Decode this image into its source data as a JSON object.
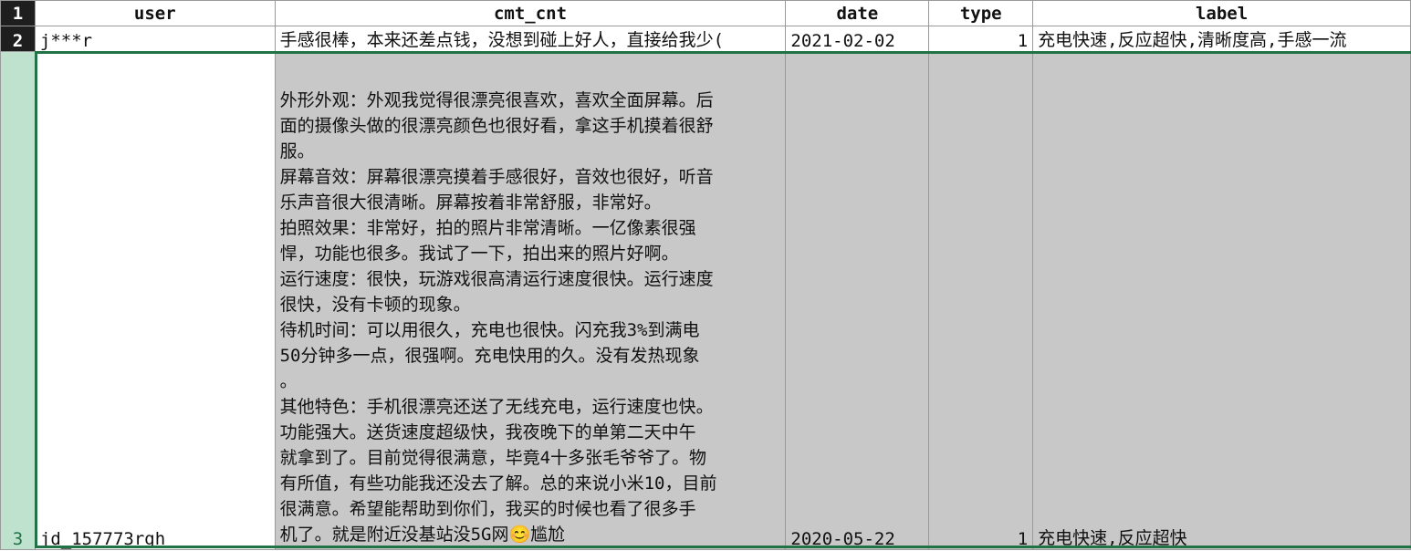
{
  "columns": [
    "user",
    "cmt_cnt",
    "date",
    "type",
    "label"
  ],
  "row_numbers": [
    "1",
    "2",
    "3"
  ],
  "rows": [
    {
      "user": "j***r",
      "cmt_cnt": "手感很棒，本来还差点钱，没想到碰上好人，直接给我少(",
      "date": "2021-02-02",
      "type": "1",
      "label": "充电快速,反应超快,清晰度高,手感一流"
    },
    {
      "user": "jd_157773rgh",
      "cmt_cnt": "外形外观：外观我觉得很漂亮很喜欢，喜欢全面屏幕。后\n面的摄像头做的很漂亮颜色也很好看，拿这手机摸着很舒\n服。\n屏幕音效：屏幕很漂亮摸着手感很好，音效也很好，听音\n乐声音很大很清晰。屏幕按着非常舒服，非常好。\n拍照效果：非常好，拍的照片非常清晰。一亿像素很强\n悍，功能也很多。我试了一下，拍出来的照片好啊。\n运行速度：很快，玩游戏很高清运行速度很快。运行速度\n很快，没有卡顿的现象。\n待机时间：可以用很久，充电也很快。闪充我3%到满电\n50分钟多一点，很强啊。充电快用的久。没有发热现象\n。\n其他特色：手机很漂亮还送了无线充电，运行速度也快。\n功能强大。送货速度超级快，我夜晚下的单第二天中午\n就拿到了。目前觉得很满意，毕竟4十多张毛爷爷了。物\n有所值，有些功能我还没去了解。总的来说小米10，目前\n很满意。希望能帮助到你们，我买的时候也看了很多手\n机了。就是附近没基站没5G网😊尴尬",
      "date": "2020-05-22",
      "type": "1",
      "label": "充电快速,反应超快"
    }
  ]
}
